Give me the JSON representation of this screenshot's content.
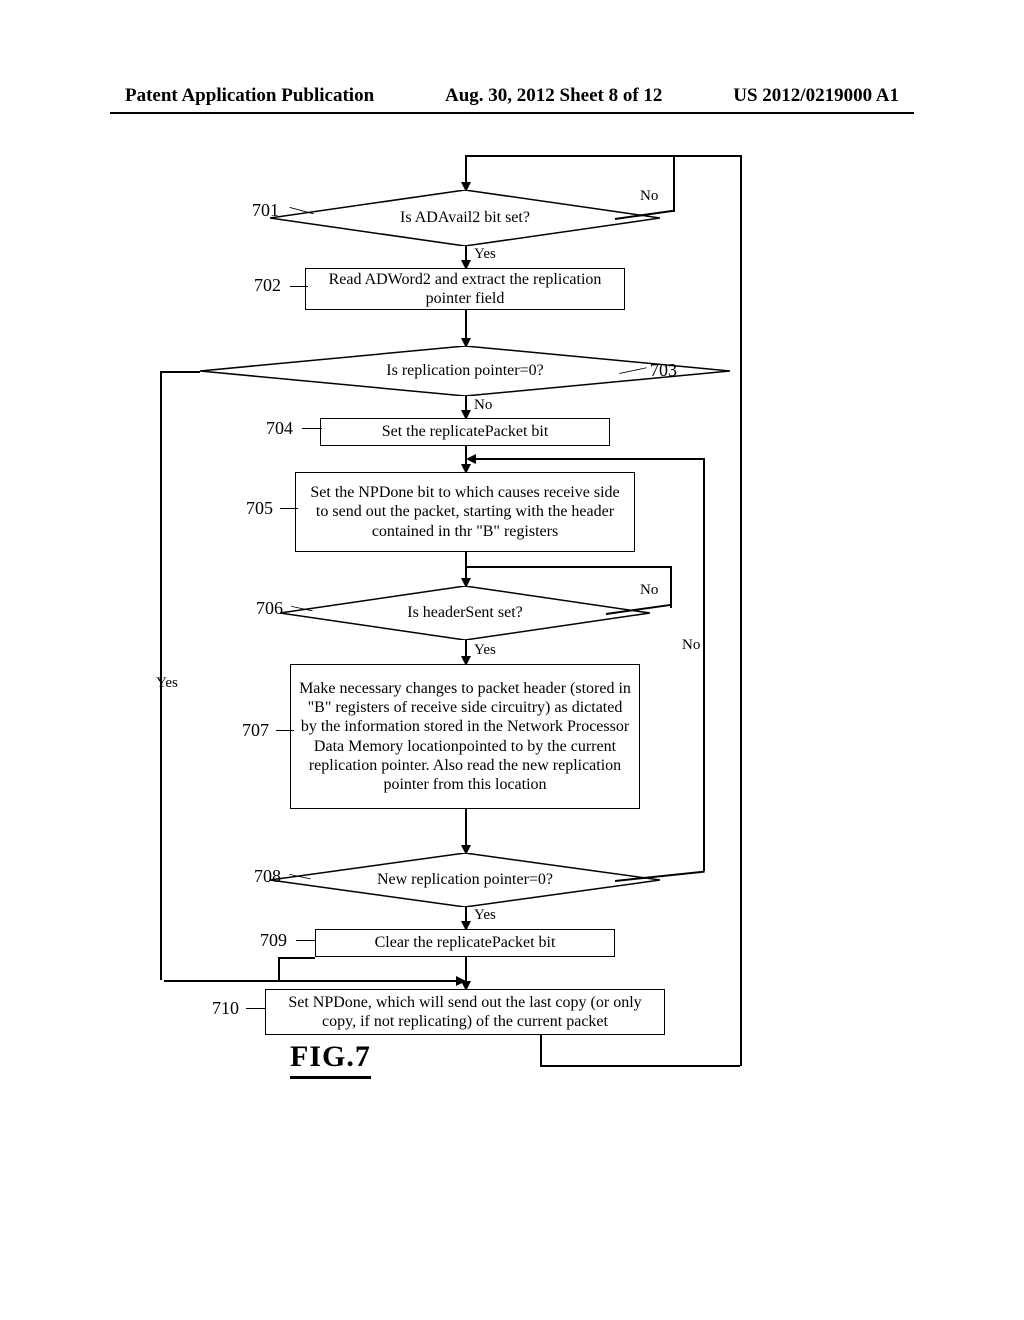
{
  "header": {
    "left": "Patent Application Publication",
    "center": "Aug. 30, 2012  Sheet 8 of 12",
    "right": "US 2012/0219000 A1"
  },
  "refs": {
    "r701": "701",
    "r702": "702",
    "r703": "703",
    "r704": "704",
    "r705": "705",
    "r706": "706",
    "r707": "707",
    "r708": "708",
    "r709": "709",
    "r710": "710"
  },
  "nodes": {
    "d701": "Is ADAvail2 bit set?",
    "b702": "Read ADWord2 and extract the replication pointer field",
    "d703": "Is replication pointer=0?",
    "b704": "Set the replicatePacket bit",
    "b705": "Set the NPDone bit to which causes receive side to send out the packet, starting with the header contained in thr \"B\" registers",
    "d706": "Is headerSent set?",
    "b707": "Make necessary changes to packet header (stored in \"B\" registers of receive side circuitry) as dictated by the information stored in the Network Processor Data Memory locationpointed to by the current replication pointer. Also read the new replication pointer from this location",
    "d708": "New replication pointer=0?",
    "b709": "Clear the replicatePacket bit",
    "b710": "Set NPDone, which will send out the last copy (or only copy, if not replicating) of the current packet"
  },
  "branch": {
    "yes": "Yes",
    "no": "No"
  },
  "figure": "FIG.7",
  "chart_data": {
    "type": "flowchart",
    "title": "FIG.7",
    "nodes": [
      {
        "id": "701",
        "shape": "decision",
        "text": "Is ADAvail2 bit set?"
      },
      {
        "id": "702",
        "shape": "process",
        "text": "Read ADWord2 and extract the replication pointer field"
      },
      {
        "id": "703",
        "shape": "decision",
        "text": "Is replication pointer=0?"
      },
      {
        "id": "704",
        "shape": "process",
        "text": "Set the replicatePacket bit"
      },
      {
        "id": "705",
        "shape": "process",
        "text": "Set the NPDone bit to which causes receive side to send out the packet, starting with the header contained in thr \"B\" registers"
      },
      {
        "id": "706",
        "shape": "decision",
        "text": "Is headerSent set?"
      },
      {
        "id": "707",
        "shape": "process",
        "text": "Make necessary changes to packet header (stored in \"B\" registers of receive side circuitry) as dictated by the information stored in the Network Processor Data Memory locationpointed to by the current replication pointer. Also read the new replication pointer from this location"
      },
      {
        "id": "708",
        "shape": "decision",
        "text": "New replication pointer=0?"
      },
      {
        "id": "709",
        "shape": "process",
        "text": "Clear the replicatePacket bit"
      },
      {
        "id": "710",
        "shape": "process",
        "text": "Set NPDone, which will send out the last copy (or only copy, if not replicating) of the current packet"
      }
    ],
    "edges": [
      {
        "from": "start",
        "to": "701"
      },
      {
        "from": "701",
        "to": "702",
        "label": "Yes"
      },
      {
        "from": "701",
        "to": "701",
        "label": "No",
        "note": "loop back to self via top"
      },
      {
        "from": "702",
        "to": "703"
      },
      {
        "from": "703",
        "to": "704",
        "label": "No"
      },
      {
        "from": "703",
        "to": "710",
        "label": "Yes",
        "note": "bypass via left side directly to 710"
      },
      {
        "from": "704",
        "to": "705"
      },
      {
        "from": "705",
        "to": "706"
      },
      {
        "from": "706",
        "to": "707",
        "label": "Yes"
      },
      {
        "from": "706",
        "to": "706",
        "label": "No",
        "note": "loop back to self"
      },
      {
        "from": "707",
        "to": "708"
      },
      {
        "from": "708",
        "to": "709",
        "label": "Yes"
      },
      {
        "from": "708",
        "to": "705",
        "label": "No",
        "note": "loop back up to before 705"
      },
      {
        "from": "709",
        "to": "710"
      },
      {
        "from": "710",
        "to": "701",
        "note": "loop back to top via far right"
      }
    ]
  }
}
